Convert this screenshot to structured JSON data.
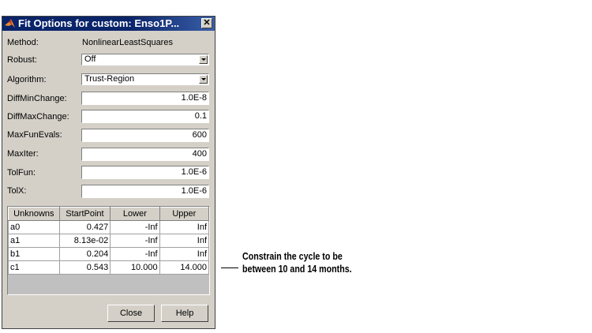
{
  "dialog": {
    "title": "Fit Options for custom: Enso1P...",
    "close_glyph": "✕"
  },
  "fields": {
    "method_label": "Method:",
    "method_value": "NonlinearLeastSquares",
    "robust_label": "Robust:",
    "robust_value": "Off",
    "algorithm_label": "Algorithm:",
    "algorithm_value": "Trust-Region",
    "diffminchange_label": "DiffMinChange:",
    "diffminchange_value": "1.0E-8",
    "diffmaxchange_label": "DiffMaxChange:",
    "diffmaxchange_value": "0.1",
    "maxfunevals_label": "MaxFunEvals:",
    "maxfunevals_value": "600",
    "maxiter_label": "MaxIter:",
    "maxiter_value": "400",
    "tolfun_label": "TolFun:",
    "tolfun_value": "1.0E-6",
    "tolx_label": "TolX:",
    "tolx_value": "1.0E-6"
  },
  "table": {
    "headers": [
      "Unknowns",
      "StartPoint",
      "Lower",
      "Upper"
    ],
    "rows": [
      [
        "a0",
        "0.427",
        "-Inf",
        "Inf"
      ],
      [
        "a1",
        "8.13e-02",
        "-Inf",
        "Inf"
      ],
      [
        "b1",
        "0.204",
        "-Inf",
        "Inf"
      ],
      [
        "c1",
        "0.543",
        "10.000",
        "14.000"
      ]
    ]
  },
  "buttons": {
    "close": "Close",
    "help": "Help"
  },
  "annotation": {
    "line1": "Constrain the cycle to be",
    "line2": "between 10 and 14 months."
  }
}
